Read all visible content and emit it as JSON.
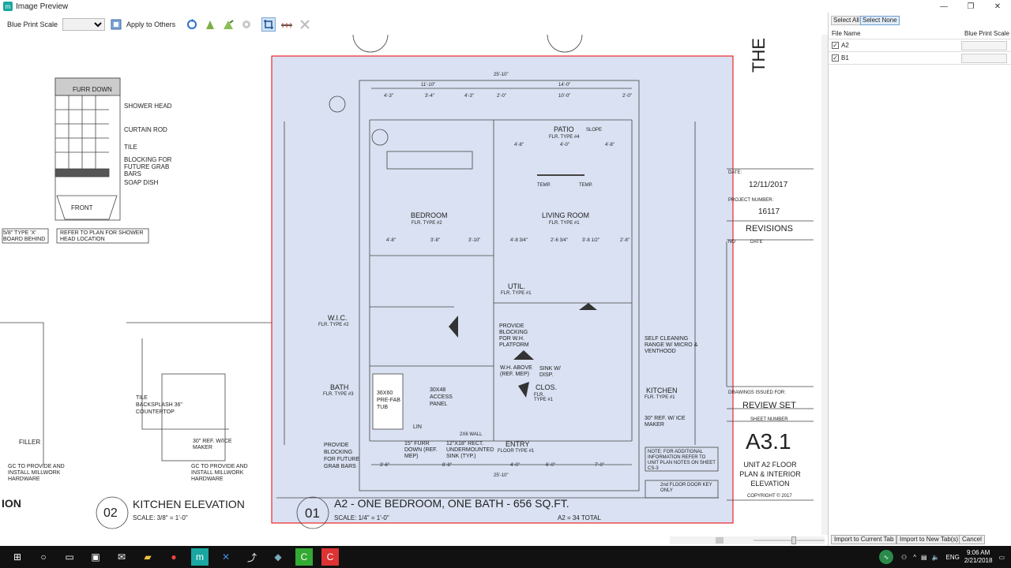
{
  "window": {
    "title": "Image Preview",
    "controls": [
      "—",
      "❐",
      "✕"
    ]
  },
  "toolbar": {
    "blueprint_scale_label": "Blue Print Scale",
    "blueprint_scale_value": "",
    "apply_to_others_label": "Apply to Others"
  },
  "blueprint": {
    "left_details": {
      "labels": [
        "FURR DOWN",
        "SHOWER HEAD",
        "CURTAIN ROD",
        "TILE",
        "BLOCKING FOR FUTURE GRAB BARS",
        "SOAP DISH",
        "FRONT",
        "5/8\" TYPE 'X' BOARD BEHIND",
        "REFER TO PLAN FOR SHOWER HEAD LOCATION",
        "FILLER",
        "GC TO PROVIDE AND INSTALL MILLWORK HARDWARE",
        "TILE BACKSPLASH 36\" COUNTERTOP",
        "30\" REF. W/ICE MAKER",
        "GC TO PROVIDE AND INSTALL MILLWORK HARDWARE"
      ],
      "elevation_number": "02",
      "elevation_title": "KITCHEN ELEVATION",
      "elevation_scale": "SCALE: 3/8\" = 1'-0\"",
      "partial_title": "ION"
    },
    "plan": {
      "rooms": [
        "PATIO",
        "BEDROOM",
        "LIVING ROOM",
        "UTIL.",
        "W.I.C.",
        "BATH",
        "CLOS.",
        "KITCHEN",
        "ENTRY"
      ],
      "floor_types": [
        "FLR. TYPE #4",
        "FLR. TYPE #2",
        "FLR. TYPE #1",
        "FLR. TYPE #1",
        "FLR. TYPE #2",
        "FLR. TYPE #3",
        "FLR. TYPE #1",
        "FLR. TYPE #1",
        "FLOOR TYPE #1"
      ],
      "dimensions": [
        "25'-10\"",
        "11'-10\"",
        "14'-0\"",
        "4'-3\"",
        "3'-4\"",
        "4'-3\"",
        "2'-0\"",
        "10'-0\"",
        "2'-0\"",
        "4'-8\"",
        "4'-0\"",
        "4'-8\"",
        "4'-8\"",
        "3'-8\"",
        "3'-10\"",
        "4'-8 3/4\"",
        "2'-6 3/4\"",
        "3'-8 1/2\"",
        "2'-8\"",
        "3'-6\"",
        "8'-8\"",
        "4'-0\"",
        "6'-0\"",
        "7'-0\"",
        "25'-10\""
      ],
      "notes": [
        "PROVIDE BLOCKING FOR W.H. PLATFORM",
        "SELF CLEANING RANGE W/ MICRO & VENTHOOD",
        "30\" REF. W/ ICE MAKER",
        "PROVIDE BLOCKING FOR FUTURE GRAB BARS",
        "15\" FURR DOWN (REF. MEP)",
        "12\"X18\" RECT. UNDERMOUNTED SINK (TYP.)",
        "W.H. ABOVE (REF. MEP)",
        "SINK W/ DISP.",
        "36X60 PRE-FAB TUB",
        "30X48 ACCESS PANEL",
        "2X6 WALL",
        "LIN",
        "TEMP.",
        "TEMP.",
        "SLOPE"
      ],
      "note_box_1": "NOTE: FOR ADDITIONAL INFORMATION REFER TO UNIT PLAN NOTES ON SHEET CS-3",
      "note_box_2": "2nd FLOOR DOOR KEY ONLY",
      "number": "01",
      "title": "A2 - ONE BEDROOM, ONE BATH - 656 SQ.FT.",
      "scale": "SCALE: 1/4\" = 1'-0\"",
      "count": "A2 = 34 TOTAL"
    },
    "title_block": {
      "project_name_partial": "THE MCKI",
      "date_label": "DATE:",
      "date": "12/11/2017",
      "project_number_label": "PROJECT NUMBER:",
      "project_number": "16117",
      "revisions": "REVISIONS",
      "rev_no": "NO",
      "rev_date": "DATE",
      "drawings_issued_label": "DRAWINGS ISSUED FOR:",
      "issued_for": "REVIEW SET",
      "sheet_number_label": "SHEET NUMBER",
      "sheet_number": "A3.1",
      "sheet_title": "UNIT A2 FLOOR PLAN & INTERIOR ELEVATION",
      "copyright": "COPYRIGHT © 2017"
    }
  },
  "panel": {
    "select_all": "Select All",
    "select_none": "Select None",
    "col_file": "File Name",
    "col_scale": "Blue Print Scale",
    "files": [
      {
        "name": "A2",
        "checked": true
      },
      {
        "name": "B1",
        "checked": true
      }
    ],
    "import_current": "Import to Current Tab",
    "import_new": "Import to New Tab(s)",
    "cancel": "Cancel"
  },
  "taskbar": {
    "language": "ENG",
    "time": "9:06 AM",
    "date": "2/21/2018"
  }
}
